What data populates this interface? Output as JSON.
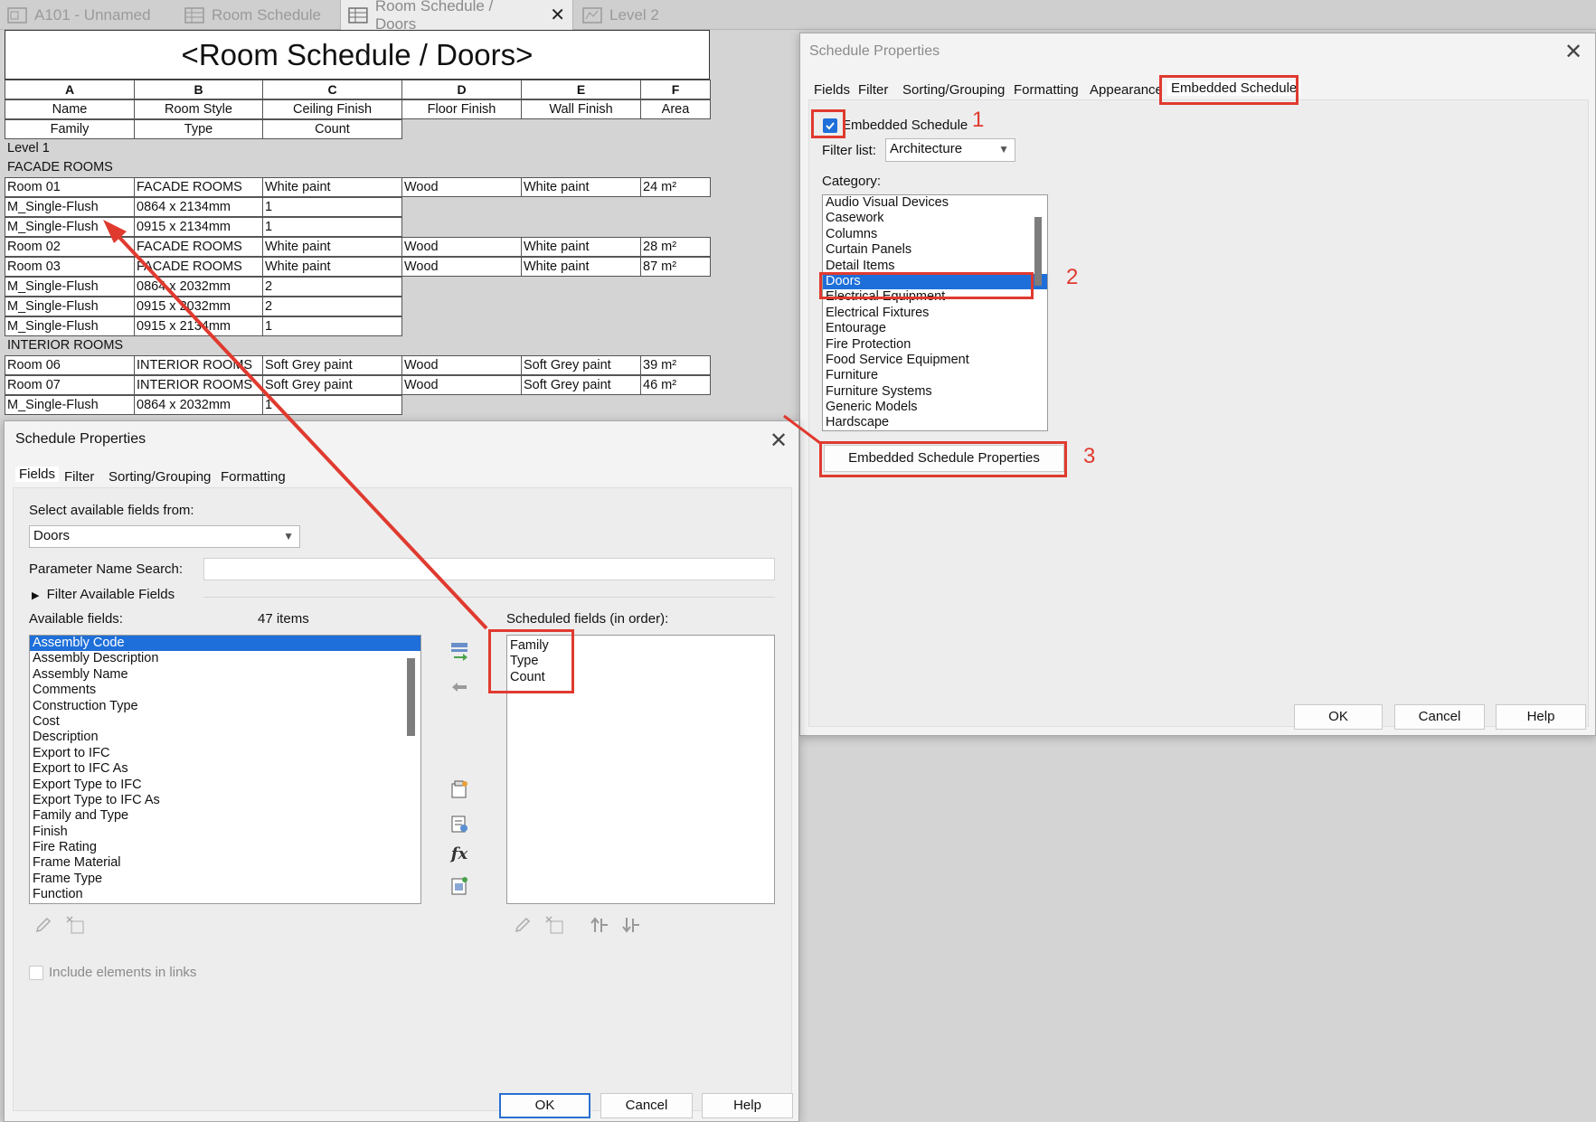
{
  "tabs": [
    {
      "label": "A101 - Unnamed",
      "icon": "sheet-icon"
    },
    {
      "label": "Room Schedule",
      "icon": "schedule-icon"
    },
    {
      "label": "Room Schedule / Doors",
      "icon": "schedule-icon",
      "active": true
    },
    {
      "label": "Level 2",
      "icon": "plan-icon"
    }
  ],
  "schedule": {
    "title": "<Room Schedule / Doors>",
    "column_letters": [
      "A",
      "B",
      "C",
      "D",
      "E",
      "F"
    ],
    "header_row1": [
      "Name",
      "Room Style",
      "Ceiling Finish",
      "Floor Finish",
      "Wall Finish",
      "Area"
    ],
    "header_row2": [
      "Family",
      "Type",
      "Count"
    ],
    "level_label": "Level 1",
    "groups": [
      {
        "name": "FACADE ROOMS",
        "rooms": [
          {
            "cells": [
              "Room 01",
              "FACADE ROOMS",
              "White paint",
              "Wood",
              "White paint",
              "24 m²"
            ],
            "doors": [
              [
                "M_Single-Flush",
                "0864 x 2134mm",
                "1"
              ],
              [
                "M_Single-Flush",
                "0915 x 2134mm",
                "1"
              ]
            ]
          },
          {
            "cells": [
              "Room 02",
              "FACADE ROOMS",
              "White paint",
              "Wood",
              "White paint",
              "28 m²"
            ],
            "doors": []
          },
          {
            "cells": [
              "Room 03",
              "FACADE ROOMS",
              "White paint",
              "Wood",
              "White paint",
              "87 m²"
            ],
            "doors": [
              [
                "M_Single-Flush",
                "0864 x 2032mm",
                "2"
              ],
              [
                "M_Single-Flush",
                "0915 x 2032mm",
                "2"
              ],
              [
                "M_Single-Flush",
                "0915 x 2134mm",
                "1"
              ]
            ]
          }
        ]
      },
      {
        "name": "INTERIOR ROOMS",
        "rooms": [
          {
            "cells": [
              "Room 06",
              "INTERIOR ROOMS",
              "Soft Grey paint",
              "Wood",
              "Soft Grey paint",
              "39 m²"
            ],
            "doors": []
          },
          {
            "cells": [
              "Room 07",
              "INTERIOR ROOMS",
              "Soft Grey paint",
              "Wood",
              "Soft Grey paint",
              "46 m²"
            ],
            "doors": [
              [
                "M_Single-Flush",
                "0864 x 2032mm",
                "1"
              ]
            ]
          }
        ]
      }
    ]
  },
  "dialog_right": {
    "title": "Schedule Properties",
    "tabs": [
      "Fields",
      "Filter",
      "Sorting/Grouping",
      "Formatting",
      "Appearance",
      "Embedded Schedule"
    ],
    "embedded_checkbox_label": "Embedded Schedule",
    "embedded_checked": true,
    "filter_list_label": "Filter list:",
    "filter_list_value": "Architecture",
    "category_label": "Category:",
    "categories": [
      "Audio Visual Devices",
      "Casework",
      "Columns",
      "Curtain Panels",
      "Detail Items",
      "Doors",
      "Electrical Equipment",
      "Electrical Fixtures",
      "Entourage",
      "Fire Protection",
      "Food Service Equipment",
      "Furniture",
      "Furniture Systems",
      "Generic Models",
      "Hardscape"
    ],
    "selected_category": "Doors",
    "embedded_props_button": "Embedded Schedule Properties",
    "ok": "OK",
    "cancel": "Cancel",
    "help": "Help",
    "annotations": [
      "1",
      "2",
      "3"
    ]
  },
  "dialog_left": {
    "title": "Schedule Properties",
    "tabs": [
      "Fields",
      "Filter",
      "Sorting/Grouping",
      "Formatting"
    ],
    "select_from_label": "Select available fields from:",
    "select_from_value": "Doors",
    "param_search_label": "Parameter Name Search:",
    "param_search_value": "",
    "filter_available_label": "Filter Available Fields",
    "available_label": "Available fields:",
    "available_count": "47 items",
    "available_fields": [
      "Assembly Code",
      "Assembly Description",
      "Assembly Name",
      "Comments",
      "Construction Type",
      "Cost",
      "Description",
      "Export to IFC",
      "Export to IFC As",
      "Export Type to IFC",
      "Export Type to IFC As",
      "Family and Type",
      "Finish",
      "Fire Rating",
      "Frame Material",
      "Frame Type",
      "Function"
    ],
    "selected_available": "Assembly Code",
    "scheduled_label": "Scheduled fields (in order):",
    "scheduled_fields": [
      "Family",
      "Type",
      "Count"
    ],
    "include_links_label": "Include elements in links",
    "ok": "OK",
    "cancel": "Cancel",
    "help": "Help"
  },
  "colors": {
    "accent": "#1e6fd9",
    "annotation": "#e03a2f"
  }
}
